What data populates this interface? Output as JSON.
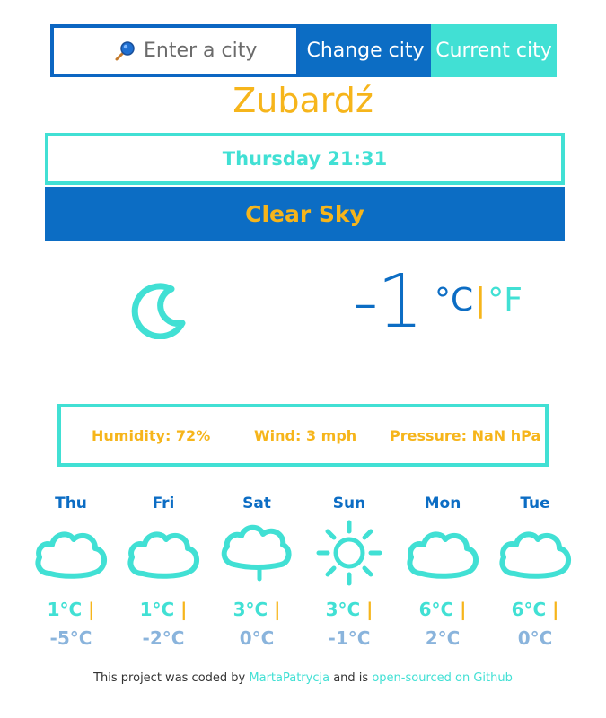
{
  "search": {
    "placeholder": "Enter a city",
    "icon": "search-icon",
    "change_label": "Change city",
    "current_label": "Current city"
  },
  "city": "Zubardź",
  "datetime": "Thursday 21:31",
  "description": "Clear Sky",
  "current": {
    "icon": "moon-icon",
    "temperature": "-1",
    "unit_c": "°C",
    "unit_sep": "|",
    "unit_f": "°F"
  },
  "details": {
    "humidity": "Humidity: 72%",
    "wind": "Wind: 3 mph",
    "pressure": "Pressure: NaN hPa"
  },
  "forecast": [
    {
      "day": "Thu",
      "icon": "cloud-icon",
      "max": "1°C",
      "bar": "|",
      "min": "-5°C"
    },
    {
      "day": "Fri",
      "icon": "cloud-icon",
      "max": "1°C",
      "bar": "|",
      "min": "-2°C"
    },
    {
      "day": "Sat",
      "icon": "cloud-rain-icon",
      "max": "3°C",
      "bar": "|",
      "min": "0°C"
    },
    {
      "day": "Sun",
      "icon": "sun-icon",
      "max": "3°C",
      "bar": "|",
      "min": "-1°C"
    },
    {
      "day": "Mon",
      "icon": "cloud-icon",
      "max": "6°C",
      "bar": "|",
      "min": "2°C"
    },
    {
      "day": "Tue",
      "icon": "cloud-icon",
      "max": "6°C",
      "bar": "|",
      "min": "0°C"
    }
  ],
  "footer": {
    "text1": "This project was coded by",
    "author_link": "MartaPatrycja",
    "text2": "and is",
    "github_link": "open-sourced on Github"
  },
  "colors": {
    "primary_blue": "#0c6dc4",
    "turquoise": "#41e0d4",
    "gold": "#f6b51b",
    "muted_blue": "#8ab4dc"
  }
}
